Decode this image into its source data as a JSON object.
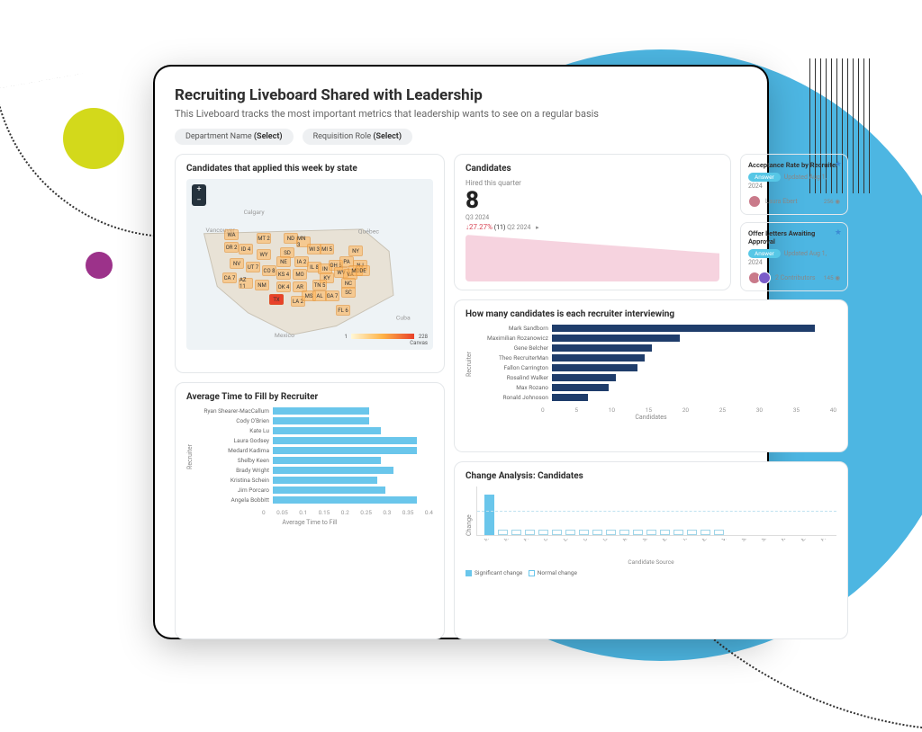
{
  "header": {
    "title": "Recruiting Liveboard Shared with Leadership",
    "subtitle": "This Liveboard tracks the most important metrics that leadership wants to see on a regular basis"
  },
  "filters": {
    "department_label": "Department Name",
    "department_value": "(Select)",
    "role_label": "Requisition Role",
    "role_value": "(Select)"
  },
  "map_card": {
    "title": "Candidates that applied this week by state",
    "legend_min": "1",
    "legend_max": "228",
    "legend_caption": "Canvas"
  },
  "candidates_card": {
    "title": "Candidates",
    "subtitle": "Hired this quarter",
    "value": "8",
    "period": "Q3 2024",
    "delta": "↓27.27%",
    "compare_count": "(11)",
    "compare_period": "Q2 2024"
  },
  "tile_acceptance": {
    "title": "Acceptance Rate by Recruiter",
    "tag": "Answer",
    "updated": "Updated Aug 1, 2024",
    "author": "Laura Ebert",
    "count": "256"
  },
  "tile_offers": {
    "title": "Offer Letters Awaiting Approval",
    "tag": "Answer",
    "updated": "Updated Aug 1, 2024",
    "author": "2 Contributors",
    "count": "145"
  },
  "avg_fill": {
    "title": "Average Time to Fill by Recruiter",
    "xlabel": "Average Time to Fill",
    "ylabel": "Recruiter"
  },
  "recruiter_interview": {
    "title": "How many candidates is each recruiter interviewing",
    "xlabel": "Candidates",
    "ylabel": "Recruiter"
  },
  "change_card": {
    "title": "Change Analysis: Candidates",
    "legend_sig": "Significant change",
    "legend_norm": "Normal change",
    "xlabel": "Candidate Source",
    "ylabel": "Change"
  },
  "chart_data": [
    {
      "type": "bar",
      "orientation": "horizontal",
      "title": "Average Time to Fill by Recruiter",
      "xlabel": "Average Time to Fill",
      "ylabel": "Recruiter",
      "xlim": [
        0,
        0.4
      ],
      "xticks": [
        0,
        0.05,
        0.1,
        0.15,
        0.2,
        0.25,
        0.3,
        0.35,
        0.4
      ],
      "categories": [
        "Ryan Shearer-MacCallum",
        "Cody O'Brien",
        "Kate Lu",
        "Laura Godsey",
        "Medard Kadima",
        "Shelby Keen",
        "Brady Wright",
        "Kristina Schein",
        "Jim Porcaro",
        "Angela Bobbitt"
      ],
      "values": [
        0.24,
        0.24,
        0.27,
        0.36,
        0.36,
        0.27,
        0.3,
        0.26,
        0.28,
        0.36
      ]
    },
    {
      "type": "bar",
      "orientation": "horizontal",
      "title": "How many candidates is each recruiter interviewing",
      "xlabel": "Candidates",
      "ylabel": "Recruiter",
      "xlim": [
        0,
        40
      ],
      "xticks": [
        0,
        5,
        10,
        15,
        20,
        25,
        30,
        35,
        40
      ],
      "categories": [
        "Mark Sandborn",
        "Maximilian Rozanowicz",
        "Gene Belcher",
        "Theo RecruiterMan",
        "Fallon Carrington",
        "Rosalind Walker",
        "Max Rozano",
        "Ronald Johnoson"
      ],
      "values": [
        37,
        18,
        14,
        13,
        12,
        9,
        8,
        5
      ]
    },
    {
      "type": "area",
      "title": "Candidates hired this quarter trend",
      "description": "small downward-sloping pink area sparkline",
      "ylim": [
        0,
        12
      ]
    },
    {
      "type": "bar",
      "title": "Change Analysis: Candidates",
      "xlabel": "Candidate Source",
      "ylabel": "Change",
      "categories": [
        "Indeed",
        "Internal",
        "Public Career",
        "Corporate",
        "LinkedIn",
        "Other",
        "University",
        "Recruitment",
        "Street Walk",
        "Employee",
        "Talentin",
        "Experteer",
        "Vetted",
        "Sour Wire",
        "Seasonal",
        "Hospitality",
        "Entertainer",
        "Packagin"
      ],
      "values": [
        6,
        0,
        0,
        0,
        0,
        0,
        0,
        0,
        0,
        0,
        0,
        0,
        0,
        0,
        0,
        0,
        0,
        0
      ],
      "series_style": {
        "significant": "#6ac6eb",
        "normal": "outline"
      }
    },
    {
      "type": "map",
      "title": "Candidates that applied this week by state",
      "region": "US states choropleth",
      "value_range": [
        1,
        228
      ],
      "visible_state_labels": [
        "WA",
        "OR 2",
        "ID 4",
        "NV",
        "CA 7",
        "AZ 11",
        "UT 7",
        "MT 2",
        "WY",
        "CO 8",
        "NM",
        "TX",
        "OK 4",
        "KS 4",
        "NE",
        "SD",
        "ND",
        "MN 3",
        "IA 2",
        "MO",
        "AR",
        "LA 2",
        "MS",
        "AL",
        "GA 7",
        "FL 6",
        "SC",
        "NC",
        "TN 5",
        "KY",
        "WV",
        "VA",
        "OH 5",
        "MI 5",
        "IN",
        "IL 8",
        "WI 3",
        "PA",
        "NY",
        "NJ",
        "MD",
        "DE"
      ]
    }
  ]
}
